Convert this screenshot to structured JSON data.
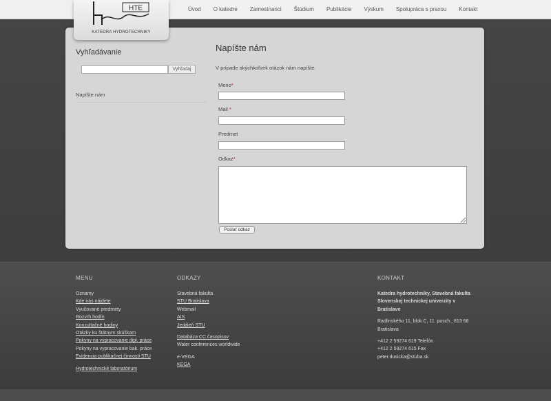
{
  "header": {
    "logo_text": "HTE",
    "logo_caption": "KATEDRA HYDROTECHNIKY",
    "nav": [
      "Úvod",
      "O katedre",
      "Zamestnanci",
      "Štúdium",
      "Publikácie",
      "Výskum",
      "Spolupráca s praxou",
      "Kontakt"
    ]
  },
  "sidebar": {
    "title": "Vyhľadávanie",
    "search_value": "",
    "search_button": "Vyhľadaj",
    "link": "Napíšte nám"
  },
  "form": {
    "title": "Napíšte nám",
    "intro": "V prípade akýchkoľvek otázok nám napíšte.",
    "name_label": "Meno",
    "mail_label": "Mail",
    "subject_label": "Predmet",
    "message_label": "Odkaz",
    "required_mark": "*",
    "submit": "Poslať odkaz"
  },
  "footer": {
    "menu": {
      "title": "MENU",
      "items": [
        "Oznamy",
        "Kde nás nájdete",
        "Vyučované predmety",
        "Rozvrh hodín",
        "Konzultačné hodiny",
        "Otázky ku štátnym skúškam",
        "Pokyny na vypracovanie dipl. práce",
        "Pokyny na vypracovanie bak. práce",
        "Evidencia publikačnej činnosti STU"
      ],
      "extra": "Hydrotechnické laboratórium"
    },
    "links": {
      "title": "ODKAZY",
      "group1": [
        "Stavebná fakulta",
        "STU Bratislava",
        "Webmail",
        "AIS",
        "Jedáleň STU"
      ],
      "group2": [
        "Databáza CC časopisov",
        "Water conferences worldwide"
      ],
      "group3": [
        "e-VEGA",
        "KEGA"
      ]
    },
    "contact": {
      "title": "KONTAKT",
      "name": "Katedra hydrotechniky, Stavebná fakulta Slovenskej technickej univerzity v Bratislave",
      "address": "Radlinského 11, blok C, 11. posch., 813 68 Bratislava",
      "phone": "+412 2 59274 619 Telefón",
      "fax": "+412 2 59274 615 Fax",
      "email": "peter.dusicka@stuba.sk"
    }
  }
}
